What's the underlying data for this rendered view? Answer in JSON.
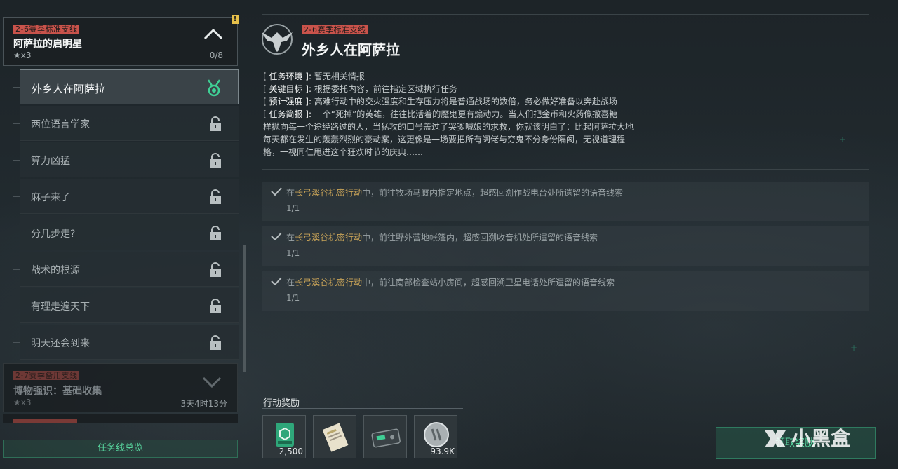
{
  "chapter": {
    "tag": "2-6赛季标准支线",
    "name": "阿萨拉的启明星",
    "stars": "★x3",
    "progress": "0/8",
    "alert": "!"
  },
  "quests": [
    {
      "label": "外乡人在阿萨拉",
      "state": "active"
    },
    {
      "label": "两位语言学家",
      "state": "locked"
    },
    {
      "label": "算力凶猛",
      "state": "locked"
    },
    {
      "label": "麻子来了",
      "state": "locked"
    },
    {
      "label": "分几步走?",
      "state": "locked"
    },
    {
      "label": "战术的根源",
      "state": "locked"
    },
    {
      "label": "有理走遍天下",
      "state": "locked"
    },
    {
      "label": "明天还会到来",
      "state": "locked"
    }
  ],
  "chapter2": {
    "tag": "2-7赛季备用支线",
    "name": "博物强识：基础收集",
    "stars": "★x3",
    "time": "3天4时13分"
  },
  "overview_button": "任务线总览",
  "detail": {
    "tag": "2-6赛季标准支线",
    "title": "外乡人在阿萨拉",
    "env_label": "[ 任务环境 ]:",
    "env": "暂无相关情报",
    "goal_label": "[ 关键目标 ]:",
    "goal": "根据委托内容，前往指定区域执行任务",
    "strength_label": "[ 预计强度 ]:",
    "strength": "高难行动中的交火强度和生存压力将是普通战场的数倍，务必做好准备以奔赴战场",
    "brief_label": "[ 任务简报 ]:",
    "brief_1": "一个“死掉”的英雄，往往比活着的魔鬼更有煽动力。当人们把金币和火药像撒喜糖一",
    "brief_2": "样抛向每一个途经路过的人，当猛攻的口号盖过了哭爹喊娘的求救，你就该明白了：比起阿萨拉大地",
    "brief_3": "每天都在发生的轰轰烈烈的豪劫案，这更像是一场要把所有阔佬与穷鬼不分身份隔阂，无视道理程",
    "brief_4": "格，一视同仁甩进这个狂欢时节的庆典……"
  },
  "objectives": [
    {
      "prefix": "在",
      "location": "长弓溪谷机密行动",
      "text": "中，前往牧场马厩内指定地点，超感回溯作战电台处所遗留的语音线索",
      "count": "1/1"
    },
    {
      "prefix": "在",
      "location": "长弓溪谷机密行动",
      "text": "中，前往野外营地帐篷内，超感回溯收音机处所遗留的语音线索",
      "count": "1/1"
    },
    {
      "prefix": "在",
      "location": "长弓溪谷机密行动",
      "text": "中，前往南部检查站小房间，超感回溯卫星电话处所遗留的语音线索",
      "count": "1/1"
    }
  ],
  "rewards_label": "行动奖励",
  "rewards": [
    {
      "icon": "green-box-icon",
      "amount": "2,500"
    },
    {
      "icon": "document-icon",
      "amount": ""
    },
    {
      "icon": "gadget-icon",
      "amount": ""
    },
    {
      "icon": "silver-coin-icon",
      "amount": "93.9K"
    }
  ],
  "claim_button": "领取奖励",
  "watermark": "小黑盒",
  "colors": {
    "tag": "#c9534b",
    "accent_green": "#57d49d",
    "location": "#c9a458"
  }
}
